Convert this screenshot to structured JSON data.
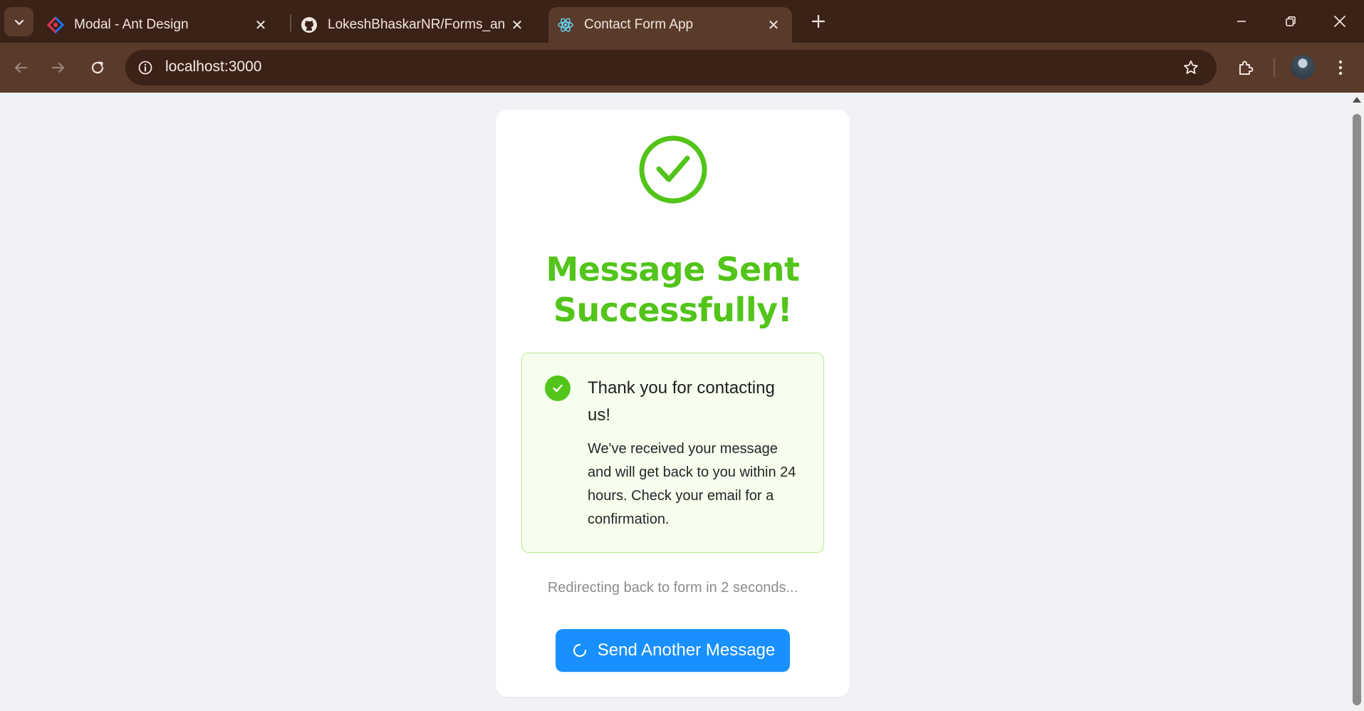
{
  "browser": {
    "tabs": [
      {
        "title": "Modal - Ant Design",
        "icon": "ant-design-logo-icon"
      },
      {
        "title": "LokeshBhaskarNR/Forms_and_U",
        "icon": "github-logo-icon"
      },
      {
        "title": "Contact Form App",
        "icon": "react-logo-icon",
        "active": true
      }
    ],
    "address": "localhost:3000"
  },
  "page": {
    "headline": "Message Sent Successfully!",
    "alert": {
      "title": "Thank you for contacting us!",
      "description": "We've received your message and will get back to you within 24 hours. Check your email for a confirmation."
    },
    "redirect_text": "Redirecting back to form in 2 seconds...",
    "send_button_label": "Send Another Message"
  },
  "colors": {
    "success": "#52c41a",
    "primary": "#1890ff",
    "alert_bg": "#f6ffed",
    "alert_border": "#b7eb8f",
    "chrome_dark": "#3a2217",
    "chrome_toolbar": "#5a3a2a"
  }
}
